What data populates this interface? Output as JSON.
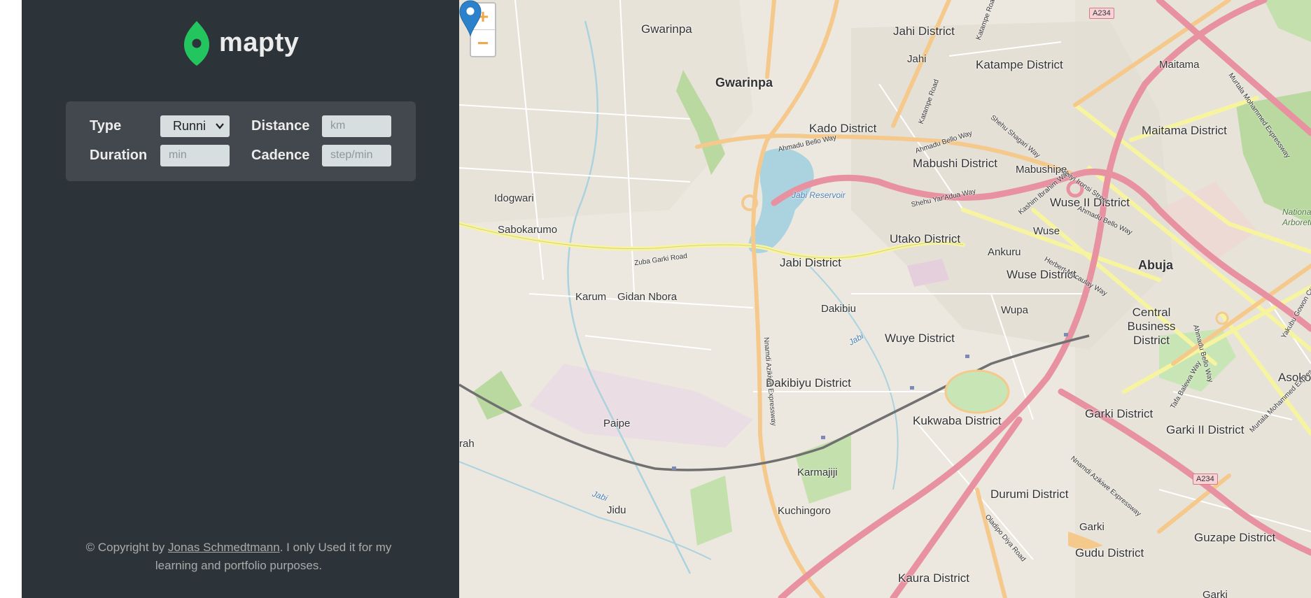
{
  "app": {
    "name": "mapty",
    "brand_color": "#22c55e",
    "sidebar_bg": "#2d3439",
    "form_bg": "#42484d"
  },
  "form": {
    "type_label": "Type",
    "type_value": "Runni",
    "distance_label": "Distance",
    "distance_placeholder": "km",
    "duration_label": "Duration",
    "duration_placeholder": "min",
    "cadence_label": "Cadence",
    "cadence_placeholder": "step/min"
  },
  "footer": {
    "prefix": "© Copyright by ",
    "author": "Jonas Schmedtmann",
    "suffix": ". I only Used it for my learning and portfolio purposes."
  },
  "map": {
    "zoom_in": "+",
    "zoom_out": "−",
    "labels": {
      "gwarinpa_n": "Gwarinpa",
      "gwarinpa": "Gwarinpa",
      "jahi_district": "Jahi District",
      "jahi": "Jahi",
      "katampe_district": "Katampe District",
      "maitama": "Maitama",
      "maitama_district": "Maitama District",
      "kado_district": "Kado District",
      "mabushi_district": "Mabushi District",
      "mabushipe": "Mabushipe",
      "idogwari": "Idogwari",
      "sabokarumo": "Sabokarumo",
      "jabi_reservoir": "Jabi Reservoir",
      "wuse_ii_district": "Wuse II District",
      "wuse": "Wuse",
      "utako_district": "Utako District",
      "ankuru": "Ankuru",
      "jabi_district": "Jabi District",
      "wuse_district": "Wuse District",
      "abuja": "Abuja",
      "karum": "Karum",
      "gidan_nbora": "Gidan Nbora",
      "dakibiu": "Dakibiu",
      "wupa": "Wupa",
      "central_business_district": "Central Business District",
      "wuye_district": "Wuye District",
      "dakibiyu_district": "Dakibiyu District",
      "asokoro": "Asokoro",
      "paipe": "Paipe",
      "kukwaba_district": "Kukwaba District",
      "garki_district": "Garki District",
      "garki_ii_district": "Garki II District",
      "rah": "rah",
      "karmajiji": "Karmajiji",
      "kuchingoro": "Kuchingoro",
      "durumi_district": "Durumi District",
      "jidu": "Jidu",
      "garki": "Garki",
      "guzape_district": "Guzape District",
      "gudu_district": "Gudu District",
      "kaura_district": "Kaura District",
      "garki_bottom": "Garki",
      "national_arboretum": "Nationa Arboretu",
      "jabi_river": "Jabi",
      "jabi_river2": "Jabi",
      "zuba_garki_road": "Zuba Garki Road",
      "ahmadu_bello_way": "Ahmadu Bello Way",
      "ahmadu_bello_way2": "Ahmadu Bello Way",
      "ahmadu_bello_way3": "Ahmadu Bello Way",
      "shehu_yaradua": "Shehu Yar'Adua Way",
      "katampe_road": "Katampe Road",
      "katampe_road2": "Katampe Road",
      "nnamdi_azikiwe": "Nnamdi Azikiwe Expressway",
      "nnamdi_azikiwe2": "Nnamdi Azikiwe Expressway",
      "olusegun_obasanjo": "Oladipo Diya Road",
      "murtala_mohammed": "Murtala Mohammed Expressway",
      "murtala_mohammed2": "Murtala Mohammed Expressway",
      "herbert_macaulay": "Herbert Macaulay Way",
      "aguiyi_ironsi": "Aguiyi Ironsi Street",
      "shehu_shagari": "Shehu Shagari Way",
      "kashim_ibrahim": "Kashim Ibrahim Way",
      "tafawa_balewa": "Tafa Balewa Way",
      "ahmadu_bello_way4": "Ahmadu Bello Way",
      "goodluck": "Yakubu Gowon Crescent"
    },
    "shields": {
      "a234_top": "A234",
      "a234_bottom": "A234"
    }
  }
}
